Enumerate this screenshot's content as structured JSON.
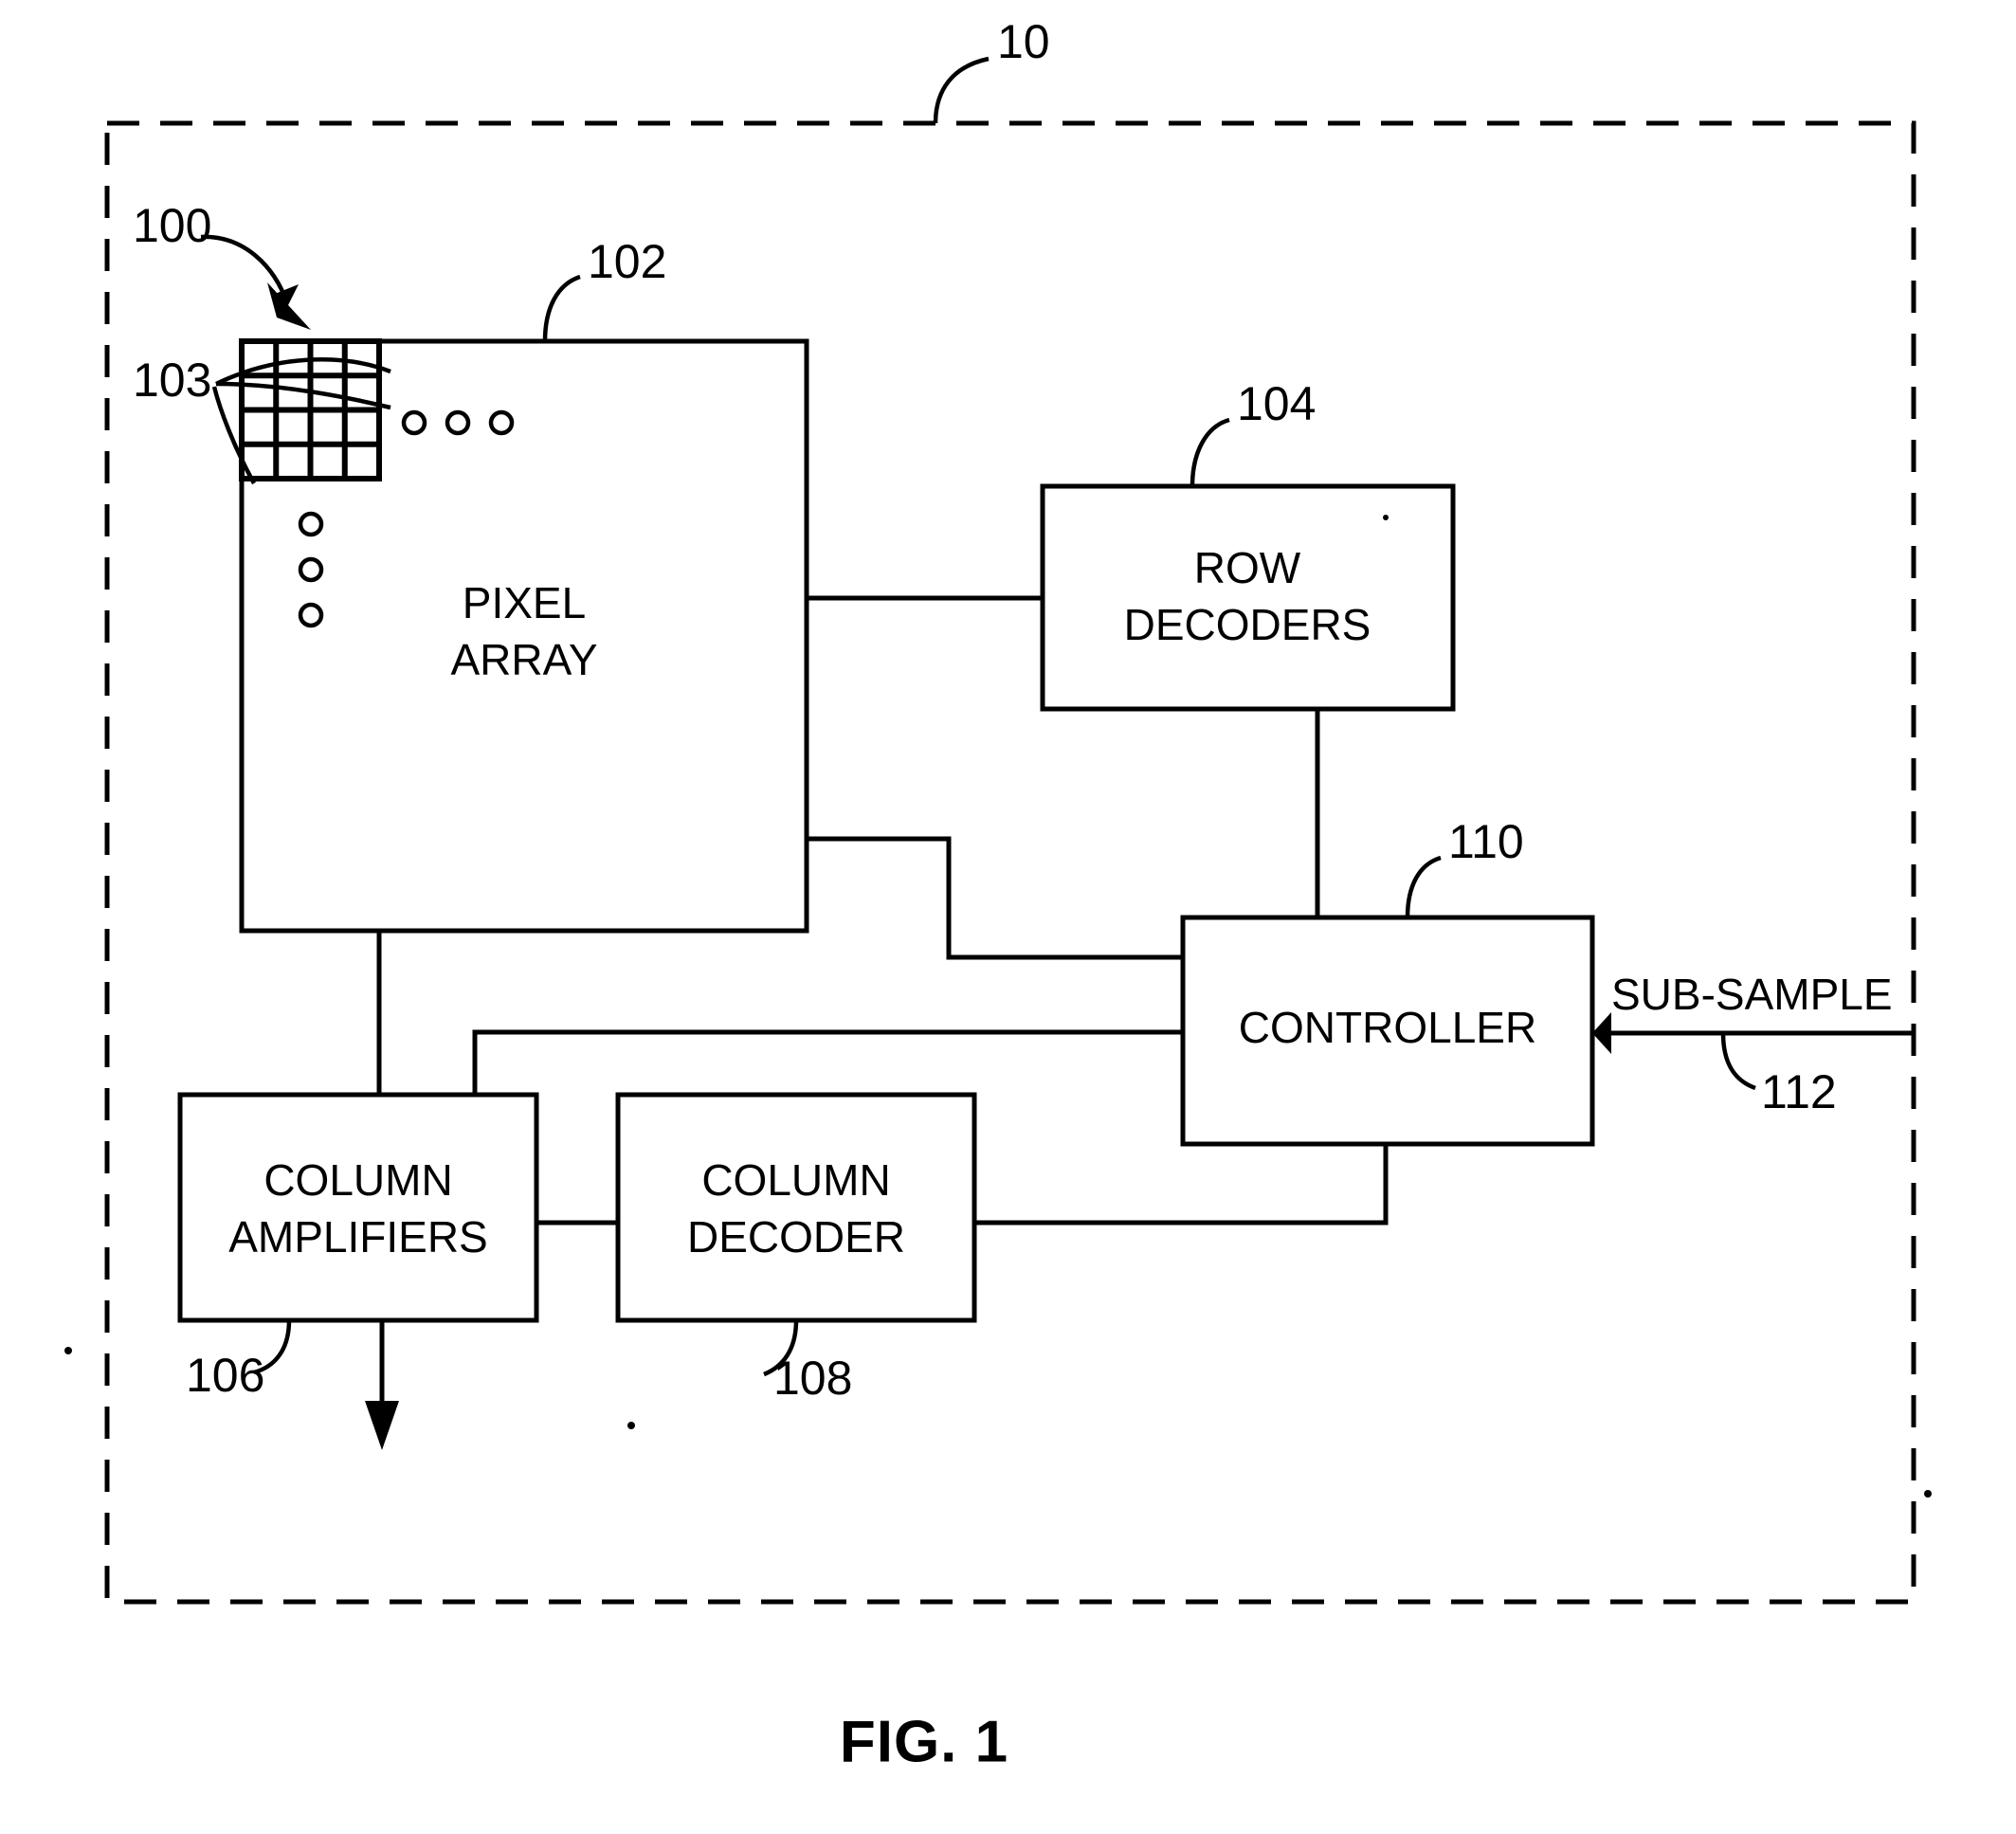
{
  "figure": {
    "caption": "FIG. 1",
    "device_ref": "10"
  },
  "blocks": {
    "pixel_array": {
      "label_line1": "PIXEL",
      "label_line2": "ARRAY",
      "ref": "102",
      "imager_ref": "100",
      "pixel_cell_ref": "103"
    },
    "row_decoders": {
      "label_line1": "ROW",
      "label_line2": "DECODERS",
      "ref": "104"
    },
    "controller": {
      "label": "CONTROLLER",
      "ref": "110"
    },
    "column_amplifiers": {
      "label_line1": "COLUMN",
      "label_line2": "AMPLIFIERS",
      "ref": "106"
    },
    "column_decoder": {
      "label_line1": "COLUMN",
      "label_line2": "DECODER",
      "ref": "108"
    }
  },
  "signals": {
    "sub_sample": {
      "label": "SUB-SAMPLE",
      "ref": "112"
    }
  },
  "colors": {
    "line": "#000000",
    "background": "#ffffff"
  },
  "grid": {
    "rows": 4,
    "cols": 4
  },
  "ellipsis": {
    "horizontal_count": 3,
    "vertical_count": 3
  }
}
